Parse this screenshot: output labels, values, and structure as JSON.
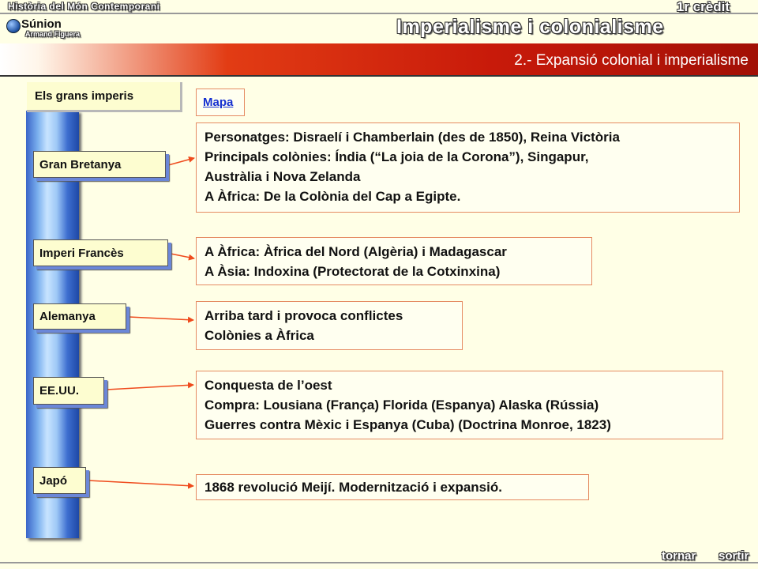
{
  "header": {
    "course": "Història del Món Contemporani",
    "credit": "1r crèdit",
    "title": "Imperialisme i colonialisme",
    "logo_name": "Súnion",
    "logo_author": "Armand Figuera"
  },
  "banner": {
    "text": "2.- Expansió colonial i imperialisme"
  },
  "section_title": "Els grans imperis",
  "map_link": "Mapa",
  "empires": [
    {
      "name": "Gran Bretanya",
      "lines": [
        "Personatges: Disraelí i Chamberlain (des de 1850), Reina Victòria",
        "Principals colònies: Índia (“La joia de la Corona”), Singapur,",
        "Austràlia i Nova Zelanda",
        "A Àfrica: De la Colònia del Cap a Egipte."
      ]
    },
    {
      "name": "Imperi Francès",
      "lines": [
        "A Àfrica: Àfrica del Nord (Algèria) i Madagascar",
        "A Àsia: Indoxina (Protectorat de la Cotxinxina)"
      ]
    },
    {
      "name": "Alemanya",
      "lines": [
        "Arriba tard i provoca conflictes",
        "Colònies a Àfrica"
      ]
    },
    {
      "name": "EE.UU.",
      "lines": [
        "Conquesta de l’oest",
        "Compra: Lousiana (França) Florida (Espanya) Alaska (Rússia)",
        "Guerres contra Mèxic i Espanya (Cuba) (Doctrina Monroe, 1823)"
      ]
    },
    {
      "name": "Japó",
      "lines": [
        "1868 revolució Meijí. Modernització i expansió."
      ]
    }
  ],
  "footer": {
    "back": "tornar",
    "exit": "sortir"
  },
  "colors": {
    "arrow": "#ef4a1c",
    "link": "#1530d0",
    "banner": "#c81a0a"
  }
}
